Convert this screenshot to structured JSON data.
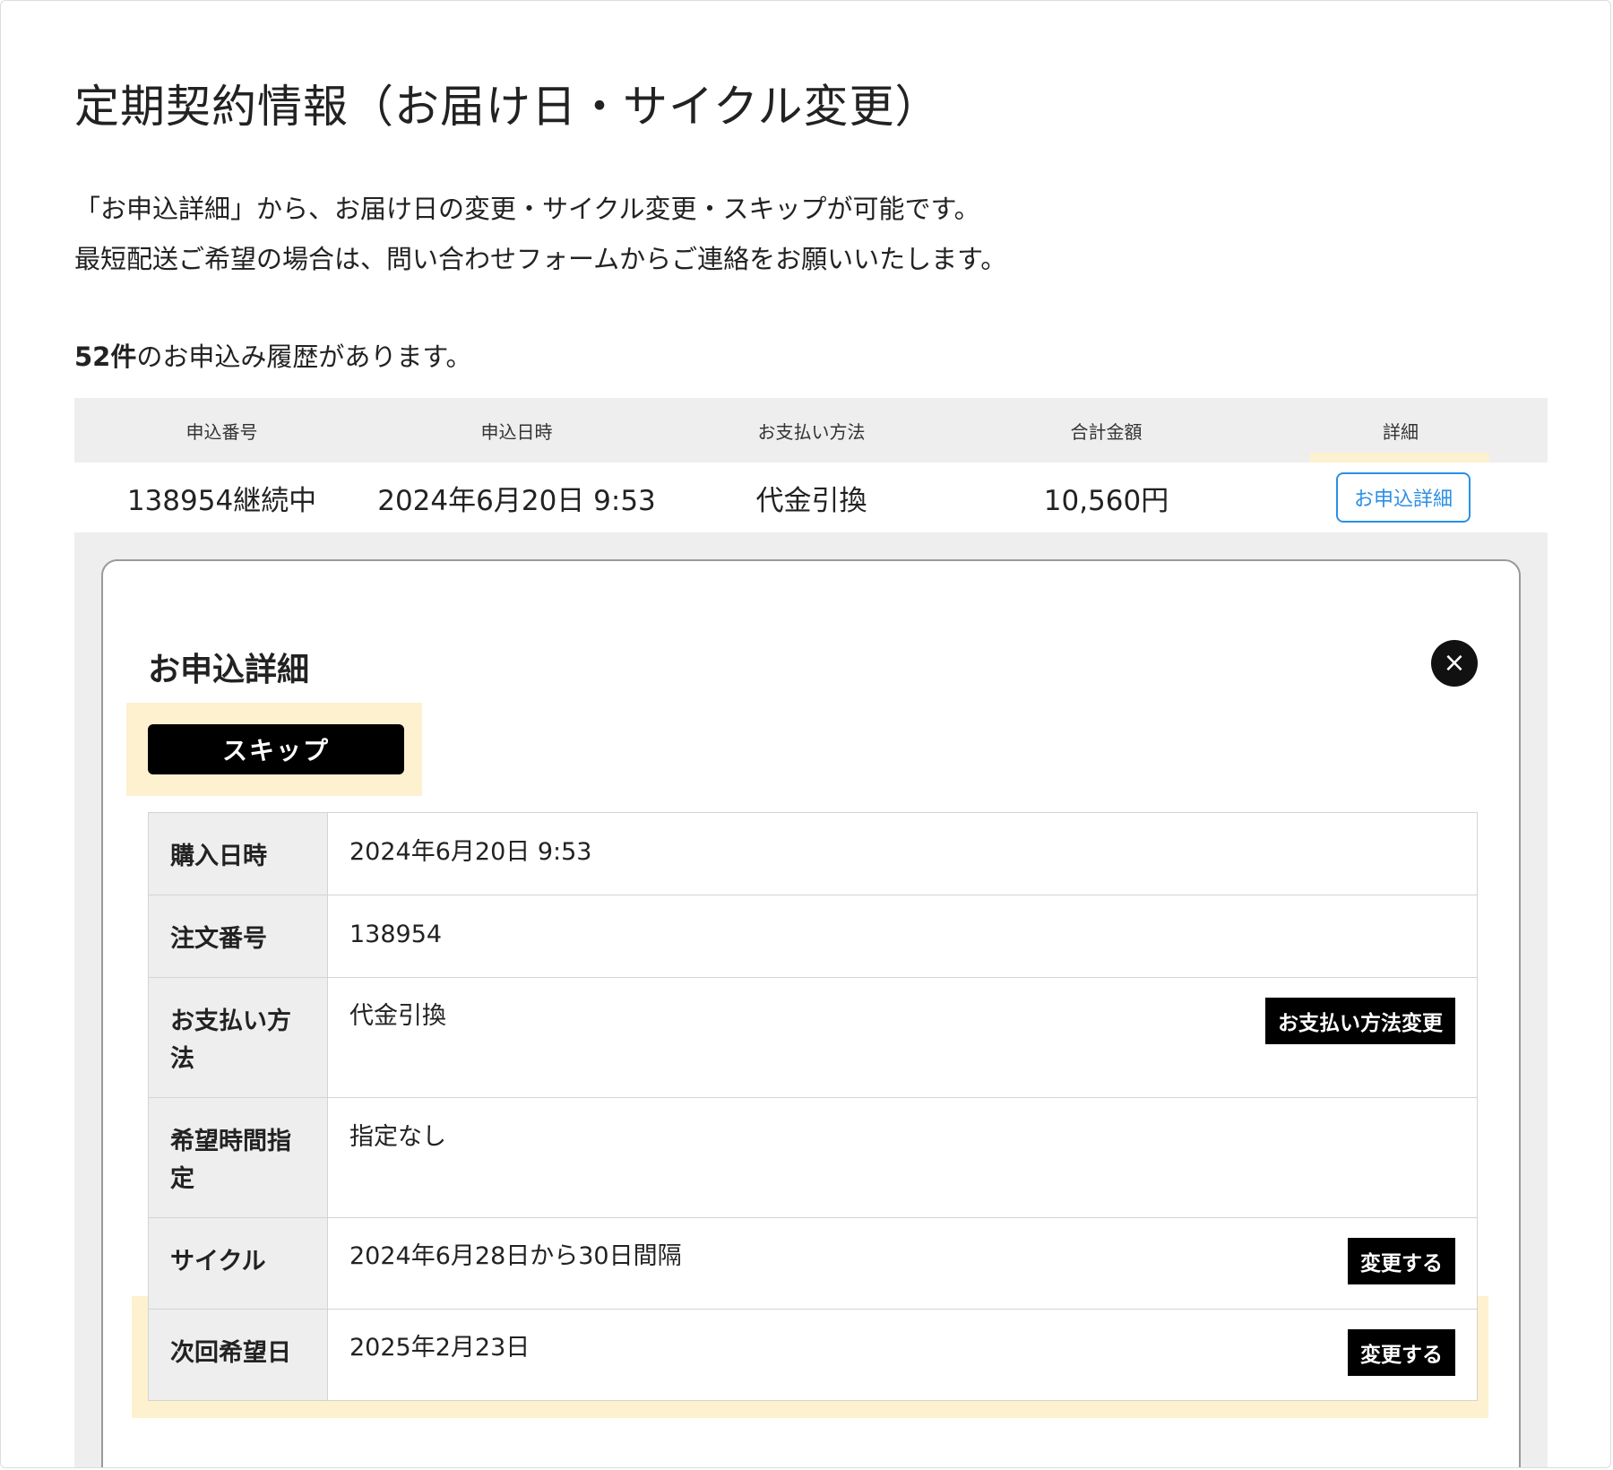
{
  "page": {
    "title": "定期契約情報（お届け日・サイクル変更）",
    "intro_line1": "「お申込詳細」から、お届け日の変更・サイクル変更・スキップが可能です。",
    "intro_line2": "最短配送ご希望の場合は、問い合わせフォームからご連絡をお願いいたします。",
    "count": "52件",
    "count_suffix": "のお申込み履歴があります。"
  },
  "orders": {
    "headers": [
      "申込番号",
      "申込日時",
      "お支払い方法",
      "合計金額",
      "詳細"
    ],
    "row": {
      "number": "138954継続中",
      "date": "2024年6月20日 9:53",
      "payment": "代金引換",
      "total": "10,560円",
      "detail_button": "お申込詳細"
    }
  },
  "detail_panel": {
    "title": "お申込詳細",
    "close_icon": "×",
    "skip_button": "スキップ",
    "rows": [
      {
        "label": "購入日時",
        "value": "2024年6月20日 9:53"
      },
      {
        "label": "注文番号",
        "value": "138954"
      },
      {
        "label": "お支払い方法",
        "value": "代金引換",
        "button": "お支払い方法変更"
      },
      {
        "label": "希望時間指定",
        "value": "指定なし"
      },
      {
        "label": "サイクル",
        "value": "2024年6月28日から30日間隔",
        "button": "変更する"
      },
      {
        "label": "次回希望日",
        "value": "2025年2月23日",
        "button": "変更する"
      }
    ]
  },
  "colors": {
    "accent_blue": "#2b8fe6",
    "highlight": "#fdf1cf",
    "header_gray": "#eeeeee"
  }
}
